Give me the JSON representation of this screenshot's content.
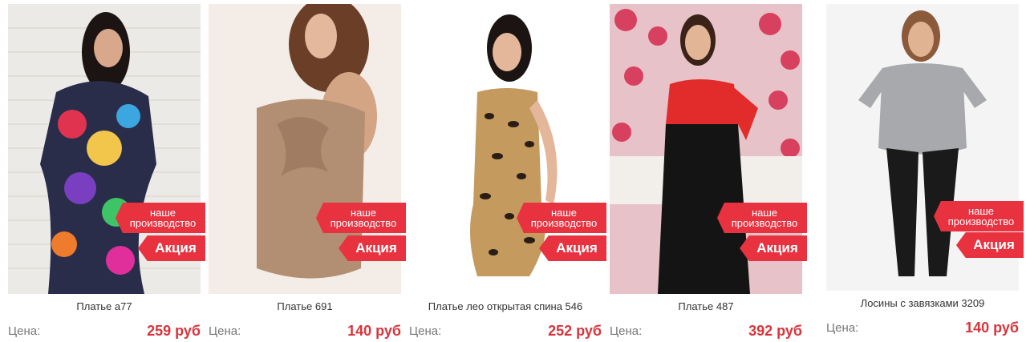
{
  "products": [
    {
      "name": "Платье а77",
      "price_label": "Цена:",
      "price": "259 руб",
      "badge_made_line1": "наше",
      "badge_made_line2": "производство",
      "badge_sale": "Акция"
    },
    {
      "name": "Платье 691",
      "price_label": "Цена:",
      "price": "140 руб",
      "badge_made_line1": "наше",
      "badge_made_line2": "производство",
      "badge_sale": "Акция"
    },
    {
      "name": "Платье лео открытая спина 546",
      "price_label": "Цена:",
      "price": "252 руб",
      "badge_made_line1": "наше",
      "badge_made_line2": "производство",
      "badge_sale": "Акция"
    },
    {
      "name": "Платье 487",
      "price_label": "Цена:",
      "price": "392 руб",
      "badge_made_line1": "наше",
      "badge_made_line2": "производство",
      "badge_sale": "Акция"
    },
    {
      "name": "Лосины с завязками 3209",
      "price_label": "Цена:",
      "price": "140 руб",
      "badge_made_line1": "наше",
      "badge_made_line2": "производство",
      "badge_sale": "Акция"
    }
  ],
  "colors": {
    "accent": "#e8323f",
    "price": "#d9343b"
  }
}
